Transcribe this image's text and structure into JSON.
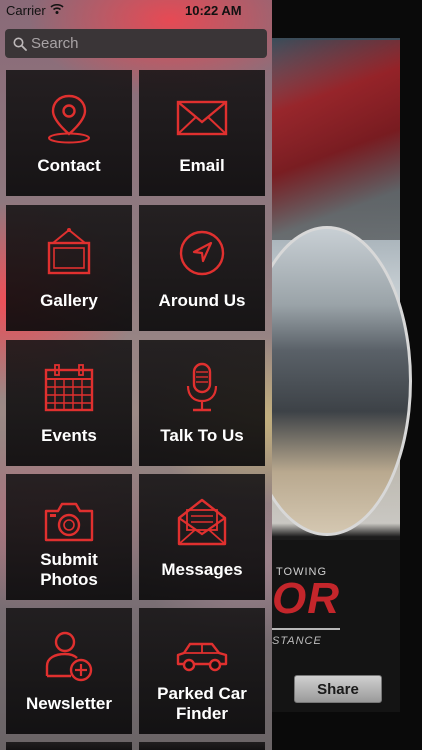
{
  "status_bar": {
    "carrier": "Carrier",
    "time": "10:22 AM"
  },
  "search": {
    "placeholder": "Search"
  },
  "menu": {
    "items": [
      {
        "label": "Contact",
        "icon": "location-pin-icon"
      },
      {
        "label": "Email",
        "icon": "envelope-icon"
      },
      {
        "label": "Gallery",
        "icon": "picture-frame-icon"
      },
      {
        "label": "Around Us",
        "icon": "compass-arrow-icon"
      },
      {
        "label": "Events",
        "icon": "calendar-icon"
      },
      {
        "label": "Talk To Us",
        "icon": "microphone-icon"
      },
      {
        "label_line1": "Submit",
        "label_line2": "Photos",
        "icon": "camera-icon"
      },
      {
        "label": "Messages",
        "icon": "open-envelope-icon"
      },
      {
        "label": "Newsletter",
        "icon": "add-user-icon"
      },
      {
        "label_line1": "Parked Car",
        "label_line2": "Finder",
        "icon": "car-icon"
      }
    ]
  },
  "background_app": {
    "towing_text": "TOWING",
    "brand_text": "OR",
    "assist_text": "STANCE",
    "share_label": "Share"
  },
  "colors": {
    "accent": "#e0302f",
    "tile_bg": "#141213",
    "label": "#ffffff"
  }
}
